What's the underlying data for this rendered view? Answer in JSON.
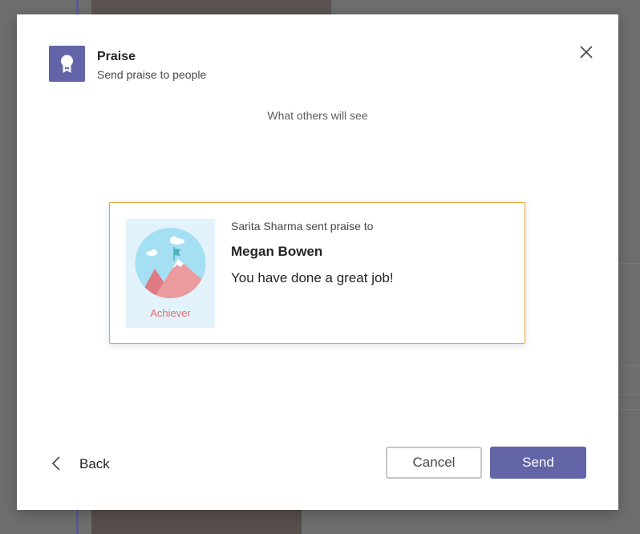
{
  "header": {
    "title": "Praise",
    "subtitle": "Send praise to people",
    "icon": "award-ribbon-icon",
    "icon_bg_color": "#6264a7"
  },
  "preview": {
    "label": "What others will see"
  },
  "praise_card": {
    "border_color": "#e7a73f",
    "badge": {
      "icon": "mountain-flag-icon",
      "label": "Achiever",
      "label_color": "#e06c75",
      "bg_color": "#e3f3fb"
    },
    "sender_line": "Sarita Sharma sent praise to",
    "recipient": "Megan Bowen",
    "message": "You have done a great job!"
  },
  "footer": {
    "back_label": "Back",
    "cancel_label": "Cancel",
    "send_label": "Send",
    "primary_color": "#6264a7"
  }
}
